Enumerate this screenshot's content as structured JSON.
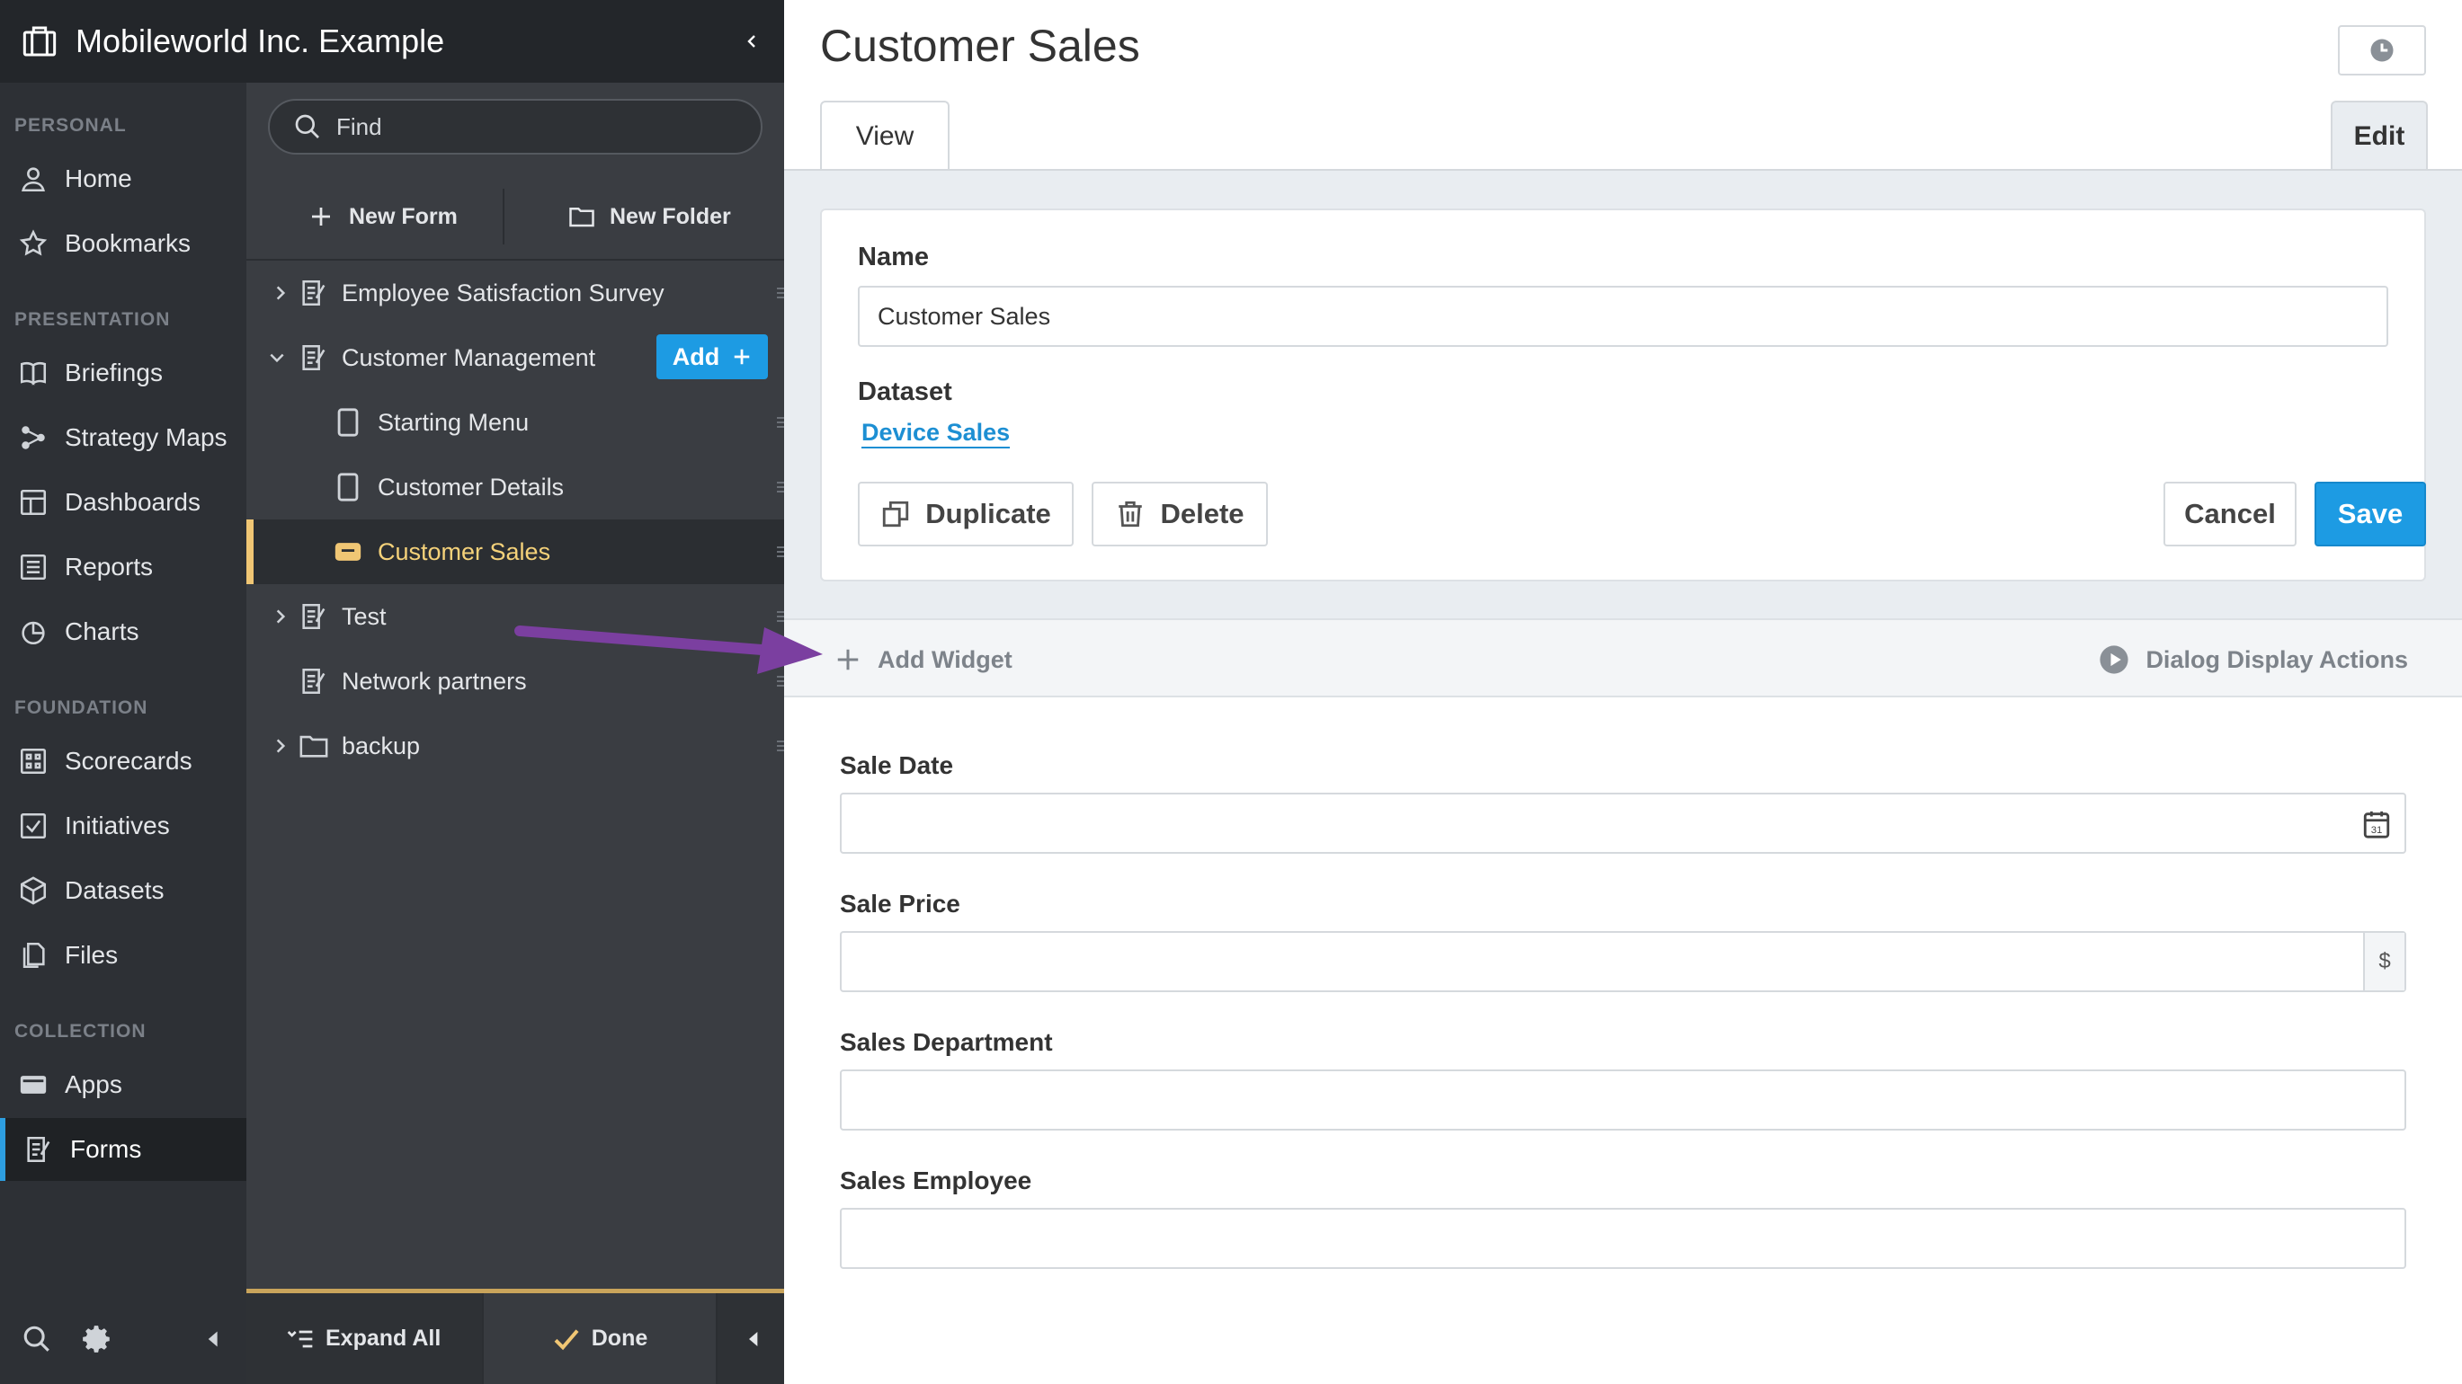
{
  "app": {
    "title": "Mobileworld Inc. Example"
  },
  "nav": {
    "sections": {
      "personal": "PERSONAL",
      "presentation": "PRESENTATION",
      "foundation": "FOUNDATION",
      "collection": "COLLECTION"
    },
    "items": {
      "home": "Home",
      "bookmarks": "Bookmarks",
      "briefings": "Briefings",
      "strategy_maps": "Strategy Maps",
      "dashboards": "Dashboards",
      "reports": "Reports",
      "charts": "Charts",
      "scorecards": "Scorecards",
      "initiatives": "Initiatives",
      "datasets": "Datasets",
      "files": "Files",
      "apps": "Apps",
      "forms": "Forms"
    },
    "active_item": "Forms",
    "accent_color": "#2d9ee0"
  },
  "tree": {
    "search_placeholder": "Find",
    "new_form_label": "New Form",
    "new_folder_label": "New Folder",
    "add_label": "Add",
    "rows": [
      {
        "label": "Employee Satisfaction Survey",
        "icon": "form-icon",
        "expanded": false
      },
      {
        "label": "Customer Management",
        "icon": "form-icon",
        "expanded": true
      },
      {
        "label": "Starting Menu",
        "icon": "page-icon"
      },
      {
        "label": "Customer Details",
        "icon": "page-icon"
      },
      {
        "label": "Customer Sales",
        "icon": "dialog-icon",
        "selected": true
      },
      {
        "label": "Test",
        "icon": "form-icon",
        "expanded": false
      },
      {
        "label": "Network partners",
        "icon": "form-icon"
      },
      {
        "label": "backup",
        "icon": "folder-icon",
        "expanded": false
      }
    ],
    "expand_all_label": "Expand All",
    "done_label": "Done",
    "selected_color": "#f0c674"
  },
  "main": {
    "title": "Customer Sales",
    "tabs": {
      "view": "View",
      "edit": "Edit"
    },
    "name_label": "Name",
    "name_value": "Customer Sales",
    "dataset_label": "Dataset",
    "dataset_value": "Device Sales",
    "duplicate_label": "Duplicate",
    "delete_label": "Delete",
    "cancel_label": "Cancel",
    "save_label": "Save",
    "add_widget_label": "Add Widget",
    "dialog_actions_label": "Dialog Display Actions",
    "fields": {
      "sale_date": "Sale Date",
      "sale_price": "Sale Price",
      "currency": "$",
      "sales_department": "Sales Department",
      "sales_employee": "Sales Employee"
    },
    "primary_color": "#1d9be3",
    "annotation_arrow_color": "#7b3fa0"
  }
}
